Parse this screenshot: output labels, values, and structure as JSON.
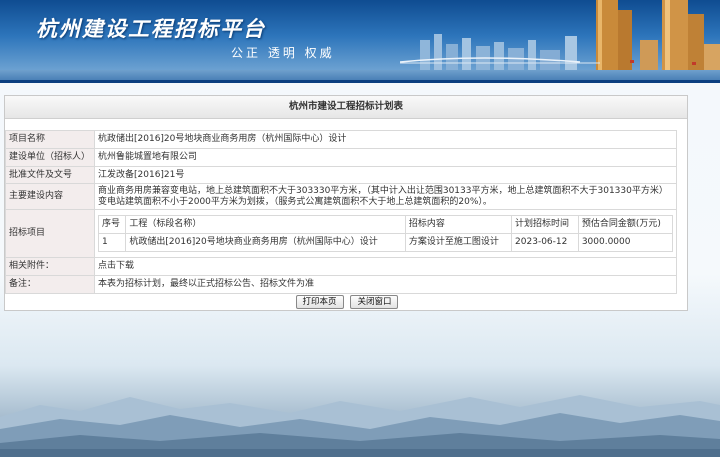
{
  "banner": {
    "title": "杭州建设工程招标平台",
    "slogan": "公正 透明 权威"
  },
  "panel": {
    "header": "杭州市建设工程招标计划表"
  },
  "fields": {
    "project_name": {
      "label": "项目名称",
      "value": "杭政储出[2016]20号地块商业商务用房（杭州国际中心）设计"
    },
    "builder": {
      "label": "建设单位（招标人）",
      "value": "杭州鲁能城置地有限公司"
    },
    "approval": {
      "label": "批准文件及文号",
      "value": "江发改备[2016]21号"
    },
    "content": {
      "label": "主要建设内容",
      "value": "商业商务用房兼容变电站，地上总建筑面积不大于303330平方米，（其中计入出让范围30133平方米，地上总建筑面积不大于301330平方米）变电站建筑面积不小于2000平方米为划拨，（服务式公寓建筑面积不大于地上总建筑面积的20%）。"
    },
    "items": {
      "label": "招标项目",
      "headers": {
        "no": "序号",
        "name": "工程（标段名称）",
        "content": "招标内容",
        "time": "计划招标时间",
        "amount": "预估合同金额(万元)"
      },
      "rows": [
        {
          "no": "1",
          "name": "杭政储出[2016]20号地块商业商务用房（杭州国际中心）设计",
          "content": "方案设计至施工图设计",
          "time": "2023-06-12",
          "amount": "3000.0000"
        }
      ]
    },
    "attachments": {
      "label": "相关附件：",
      "value": "点击下载"
    },
    "remark": {
      "label": "备注：",
      "value": "本表为招标计划，最终以正式招标公告、招标文件为准"
    }
  },
  "buttons": {
    "print": "打印本页",
    "close": "关闭窗口"
  }
}
